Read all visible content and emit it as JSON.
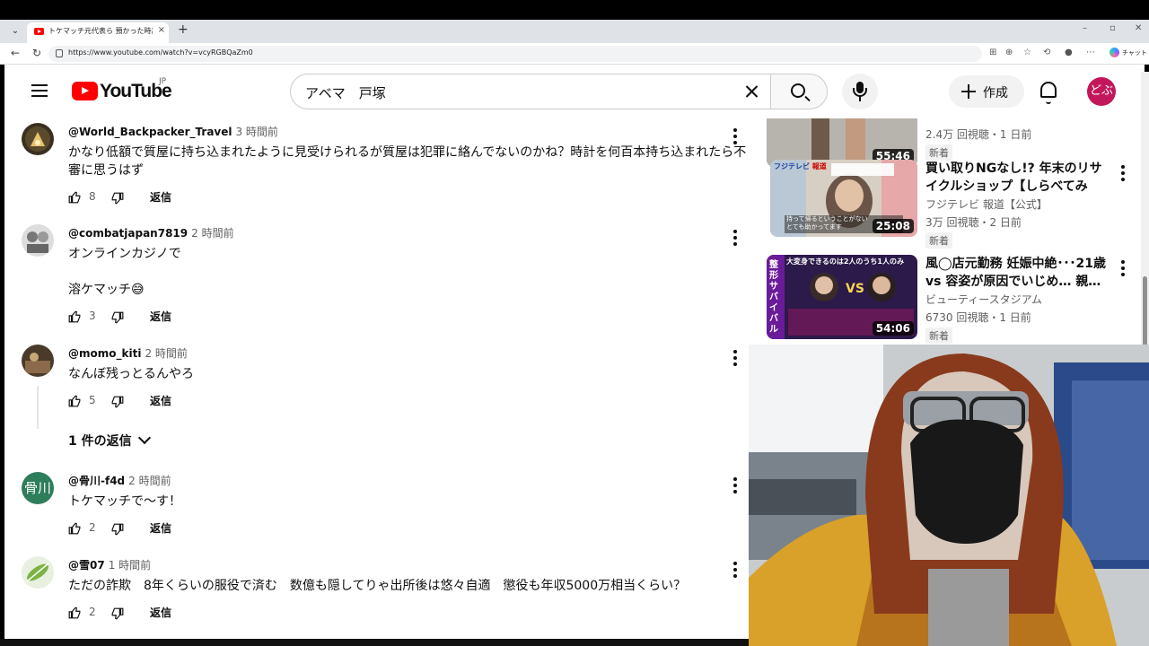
{
  "browser": {
    "tab_title": "トケマッチ元代表ら 預かった時計売...",
    "tab_close": "×",
    "new_tab": "+",
    "url": "https://www.youtube.com/watch?v=vcyRGBQaZm0",
    "copilot_label": "チャット"
  },
  "youtube": {
    "wordmark": "YouTube",
    "country": "JP",
    "search_value": "アベマ　戸塚",
    "create_label": "作成",
    "avatar_text": "どぶ"
  },
  "comments": [
    {
      "author": "@World_Backpacker_Travel",
      "time": "3 時間前",
      "text": "かなり低額で質屋に持ち込まれたように見受けられるが質屋は犯罪に絡んでないのかね？時計を何百本持ち込まれたら不審に思うはず",
      "likes": "8",
      "reply_label": "返信"
    },
    {
      "author": "@combatjapan7819",
      "time": "2 時間前",
      "text_line1": "オンラインカジノで",
      "text_line2": "溶ケマッチ😅",
      "likes": "3",
      "reply_label": "返信"
    },
    {
      "author": "@momo_kiti",
      "time": "2 時間前",
      "text": "なんぼ残っとるんやろ",
      "likes": "5",
      "reply_label": "返信",
      "replies_toggle": "1 件の返信"
    },
    {
      "author": "@骨川-f4d",
      "time": "2 時間前",
      "text": "トケマッチで〜す！",
      "likes": "2",
      "reply_label": "返信",
      "avatar_text": "骨川"
    },
    {
      "author": "@雪07",
      "time": "1 時間前",
      "text": "ただの詐欺　8年くらいの服役で済む　数億も隠してりゃ出所後は悠々自適　懲役も年収5000万相当くらい？",
      "likes": "2",
      "reply_label": "返信"
    }
  ],
  "related": [
    {
      "duration": "55:46",
      "meta": "2.4万 回視聴・1 日前",
      "badge": "新着"
    },
    {
      "duration": "25:08",
      "title": "買い取りNGなし!? 年末のリサイクルショップ【しらべてみた…",
      "channel": "フジテレビ 報道【公式】",
      "meta": "3万 回視聴・2 日前",
      "badge": "新着",
      "thumb_logo": "フジテレビ",
      "thumb_logo2": "報道",
      "thumb_caption": "持って帰るということがない\nとても助かってます"
    },
    {
      "duration": "54:06",
      "title": "風◯店元勤務 妊娠中絶･･･21歳 vs 容姿が原因でいじめ… 親…",
      "channel": "ビューティースタジアム",
      "meta": "6730 回視聴・1 日前",
      "badge": "新着",
      "thumb_side": "整形サバイバル",
      "thumb_top": "大変身できるのは2人のうち1人のみ",
      "thumb_vs": "VS"
    }
  ],
  "colors": {
    "brand_red": "#ff0000",
    "avatar_bg": "#c2185b",
    "text_primary": "#0f0f0f",
    "text_secondary": "#606060"
  }
}
